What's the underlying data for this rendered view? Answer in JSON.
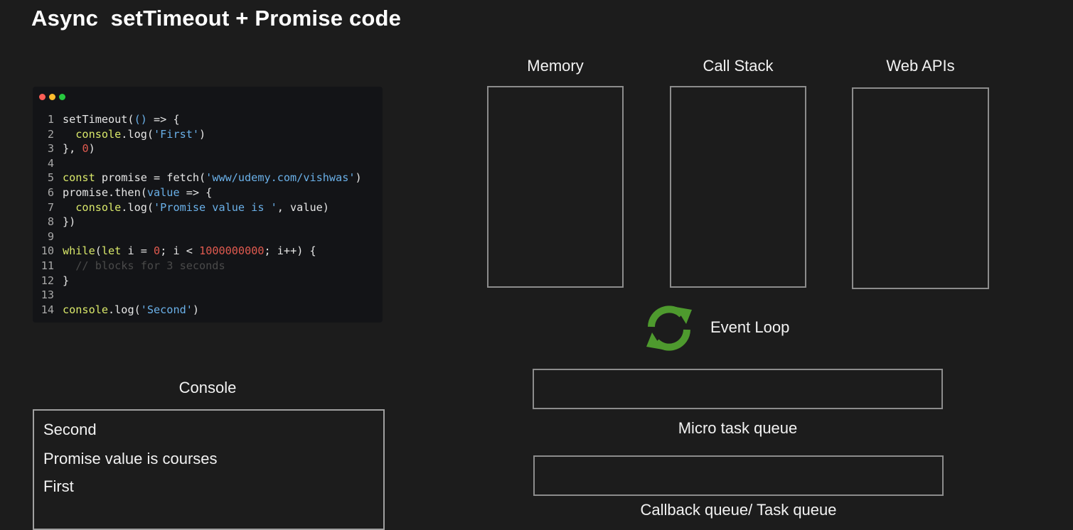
{
  "title": "Async  setTimeout + Promise code",
  "code_window": {
    "dots": [
      "#ff5f56",
      "#ffbd2e",
      "#27c93f"
    ],
    "lines": [
      {
        "n": "1",
        "tokens": [
          {
            "t": "setTimeout(",
            "c": "#e6e6e6"
          },
          {
            "t": "()",
            "c": "#6ab0e8"
          },
          {
            "t": " => {",
            "c": "#e6e6e6"
          }
        ]
      },
      {
        "n": "2",
        "tokens": [
          {
            "t": "  console",
            "c": "#d9e86a"
          },
          {
            "t": ".log(",
            "c": "#e6e6e6"
          },
          {
            "t": "'First'",
            "c": "#6ab0e8"
          },
          {
            "t": ")",
            "c": "#e6e6e6"
          }
        ]
      },
      {
        "n": "3",
        "tokens": [
          {
            "t": "}, ",
            "c": "#e6e6e6"
          },
          {
            "t": "0",
            "c": "#e05a4f"
          },
          {
            "t": ")",
            "c": "#e6e6e6"
          }
        ]
      },
      {
        "n": "4",
        "tokens": []
      },
      {
        "n": "5",
        "tokens": [
          {
            "t": "const",
            "c": "#d9e86a"
          },
          {
            "t": " promise = fetch(",
            "c": "#e6e6e6"
          },
          {
            "t": "'www/udemy.com/vishwas'",
            "c": "#6ab0e8"
          },
          {
            "t": ")",
            "c": "#e6e6e6"
          }
        ]
      },
      {
        "n": "6",
        "tokens": [
          {
            "t": "promise.then(",
            "c": "#e6e6e6"
          },
          {
            "t": "value",
            "c": "#6ab0e8"
          },
          {
            "t": " => {",
            "c": "#e6e6e6"
          }
        ]
      },
      {
        "n": "7",
        "tokens": [
          {
            "t": "  console",
            "c": "#d9e86a"
          },
          {
            "t": ".log(",
            "c": "#e6e6e6"
          },
          {
            "t": "'Promise value is '",
            "c": "#6ab0e8"
          },
          {
            "t": ", value)",
            "c": "#e6e6e6"
          }
        ]
      },
      {
        "n": "8",
        "tokens": [
          {
            "t": "})",
            "c": "#e6e6e6"
          }
        ]
      },
      {
        "n": "9",
        "tokens": []
      },
      {
        "n": "10",
        "tokens": [
          {
            "t": "while",
            "c": "#d9e86a"
          },
          {
            "t": "(",
            "c": "#e6e6e6"
          },
          {
            "t": "let",
            "c": "#d9e86a"
          },
          {
            "t": " i = ",
            "c": "#e6e6e6"
          },
          {
            "t": "0",
            "c": "#e05a4f"
          },
          {
            "t": "; i < ",
            "c": "#e6e6e6"
          },
          {
            "t": "1000000000",
            "c": "#e05a4f"
          },
          {
            "t": "; i++) {",
            "c": "#e6e6e6"
          }
        ]
      },
      {
        "n": "11",
        "tokens": [
          {
            "t": "  // blocks for 3 seconds",
            "c": "#4a4a4a"
          }
        ]
      },
      {
        "n": "12",
        "tokens": [
          {
            "t": "}",
            "c": "#e6e6e6"
          }
        ]
      },
      {
        "n": "13",
        "tokens": []
      },
      {
        "n": "14",
        "tokens": [
          {
            "t": "console",
            "c": "#d9e86a"
          },
          {
            "t": ".log(",
            "c": "#e6e6e6"
          },
          {
            "t": "'Second'",
            "c": "#6ab0e8"
          },
          {
            "t": ")",
            "c": "#e6e6e6"
          }
        ]
      }
    ]
  },
  "panels": {
    "memory": "Memory",
    "call_stack": "Call Stack",
    "web_apis": "Web APIs"
  },
  "event_loop": {
    "label": "Event Loop",
    "icon": "refresh-cycle-icon",
    "color": "#4e9a2e"
  },
  "queues": {
    "micro": "Micro task queue",
    "callback": "Callback queue/ Task queue"
  },
  "console": {
    "label": "Console",
    "lines": [
      "Second",
      "Promise value is courses",
      "First"
    ]
  }
}
